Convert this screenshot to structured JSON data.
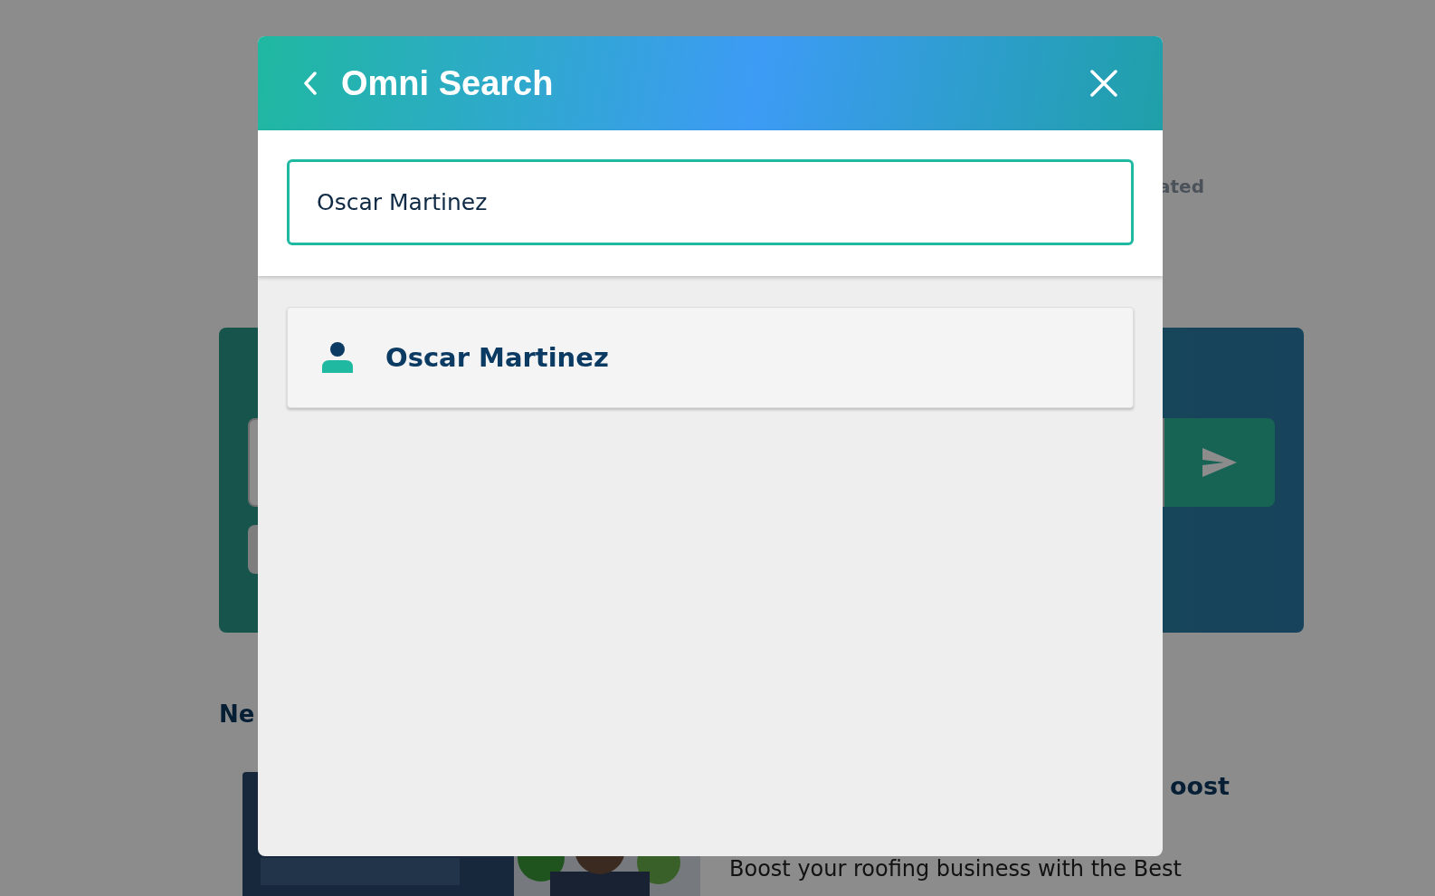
{
  "background": {
    "status_fragment": "ated",
    "news_heading_fragment": "Ne",
    "article": {
      "title_fragment": "oost",
      "summary": "Boost your roofing business with the Best"
    }
  },
  "dialog": {
    "title": "Omni Search",
    "search": {
      "value": "Oscar Martinez"
    },
    "results": [
      {
        "kind": "person",
        "label": "Oscar Martinez"
      }
    ]
  }
}
